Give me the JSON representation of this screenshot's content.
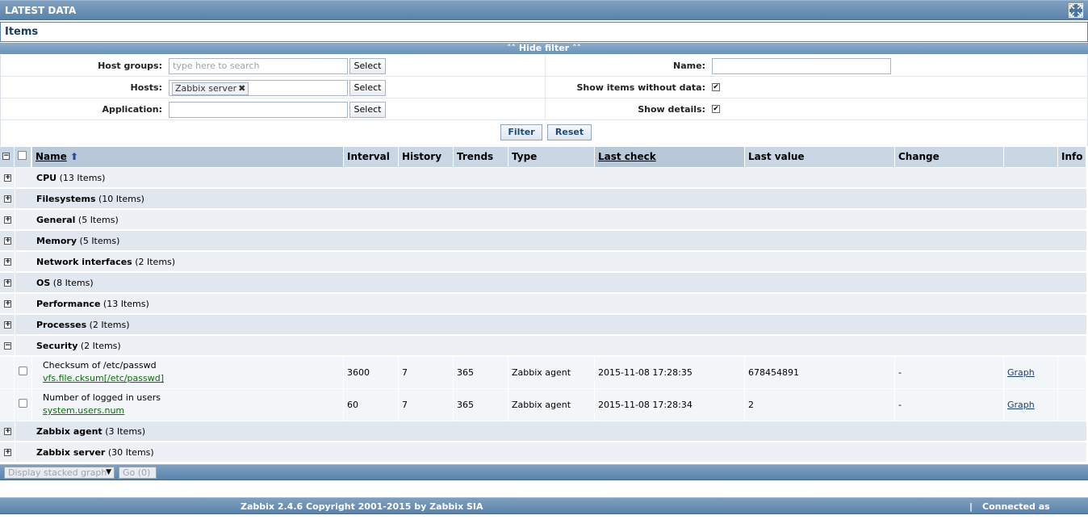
{
  "header": {
    "title": "LATEST DATA"
  },
  "items_title": "Items",
  "filter": {
    "toggle_label": "Hide filter",
    "host_groups_label": "Host groups:",
    "host_groups_placeholder": "type here to search",
    "hosts_label": "Hosts:",
    "hosts_chip": "Zabbix server",
    "application_label": "Application:",
    "select_label": "Select",
    "name_label": "Name:",
    "show_without_data_label": "Show items without data:",
    "show_details_label": "Show details:",
    "filter_button": "Filter",
    "reset_button": "Reset"
  },
  "columns": {
    "name": "Name",
    "interval": "Interval",
    "history": "History",
    "trends": "Trends",
    "type": "Type",
    "last_check": "Last check",
    "last_value": "Last value",
    "change": "Change",
    "info": "Info"
  },
  "groups": [
    {
      "name": "CPU",
      "count": "(13 Items)",
      "expanded": false
    },
    {
      "name": "Filesystems",
      "count": "(10 Items)",
      "expanded": false
    },
    {
      "name": "General",
      "count": "(5 Items)",
      "expanded": false
    },
    {
      "name": "Memory",
      "count": "(5 Items)",
      "expanded": false
    },
    {
      "name": "Network interfaces",
      "count": "(2 Items)",
      "expanded": false
    },
    {
      "name": "OS",
      "count": "(8 Items)",
      "expanded": false
    },
    {
      "name": "Performance",
      "count": "(13 Items)",
      "expanded": false
    },
    {
      "name": "Processes",
      "count": "(2 Items)",
      "expanded": false
    },
    {
      "name": "Security",
      "count": "(2 Items)",
      "expanded": true
    },
    {
      "name": "Zabbix agent",
      "count": "(3 Items)",
      "expanded": false
    },
    {
      "name": "Zabbix server",
      "count": "(30 Items)",
      "expanded": false
    }
  ],
  "security_items": [
    {
      "name": "Checksum of /etc/passwd",
      "key": "vfs.file.cksum[/etc/passwd]",
      "interval": "3600",
      "history": "7",
      "trends": "365",
      "type": "Zabbix agent",
      "last_check": "2015-11-08 17:28:35",
      "last_value": "678454891",
      "change": "-",
      "graph": "Graph"
    },
    {
      "name": "Number of logged in users",
      "key": "system.users.num",
      "interval": "60",
      "history": "7",
      "trends": "365",
      "type": "Zabbix agent",
      "last_check": "2015-11-08 17:28:34",
      "last_value": "2",
      "change": "-",
      "graph": "Graph"
    }
  ],
  "bottom": {
    "action_select": "Display stacked graph",
    "go_button": "Go (0)"
  },
  "footer": {
    "copyright": "Zabbix 2.4.6 Copyright 2001-2015 by Zabbix SIA",
    "connected": "Connected as 'Admin'"
  }
}
